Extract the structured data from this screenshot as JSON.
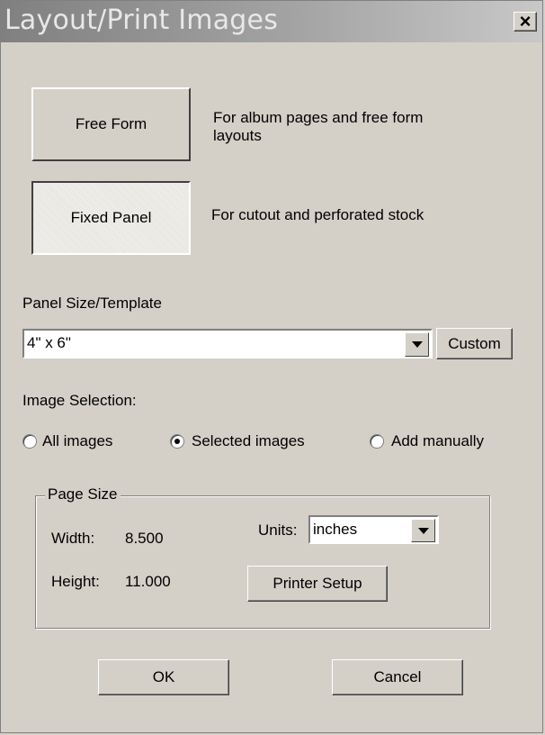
{
  "window": {
    "title": "Layout/Print Images",
    "close_label": "×"
  },
  "layout_modes": {
    "free_form_label": "Free Form",
    "free_form_desc_line1": "For album pages and free form",
    "free_form_desc_line2": "layouts",
    "fixed_panel_label": "Fixed Panel",
    "fixed_panel_desc": "For cutout and perforated stock"
  },
  "panel_size": {
    "label": "Panel Size/Template",
    "selected": "4\" x 6\"",
    "custom_label": "Custom"
  },
  "image_selection": {
    "label": "Image Selection:",
    "options": [
      {
        "label": "All images",
        "checked": false
      },
      {
        "label": "Selected images",
        "checked": true
      },
      {
        "label": "Add manually",
        "checked": false
      }
    ]
  },
  "page_size": {
    "legend": "Page Size",
    "width_label": "Width:",
    "width_value": "8.500",
    "height_label": "Height:",
    "height_value": "11.000",
    "units_label": "Units:",
    "units_selected": "inches",
    "printer_setup_label": "Printer Setup"
  },
  "footer": {
    "ok_label": "OK",
    "cancel_label": "Cancel"
  },
  "colors": {
    "dialog_bg": "#d4d0c8",
    "title_gradient_start": "#808080",
    "title_gradient_end": "#c8c8c8"
  }
}
